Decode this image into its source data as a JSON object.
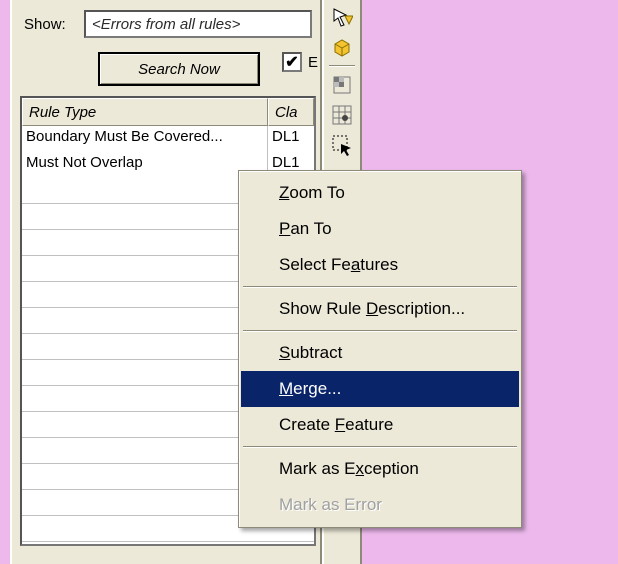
{
  "panel": {
    "show_label": "Show:",
    "show_value": "<Errors from all rules>",
    "search_button": "Search Now",
    "errors_only_check_letter": "E",
    "errors_only_checked": true
  },
  "grid": {
    "columns": [
      "Rule Type",
      "Cla"
    ],
    "rows": [
      {
        "rule": "Boundary Must Be Covered...",
        "class": "DL1"
      },
      {
        "rule": "Must Not Overlap",
        "class": "DL1"
      }
    ]
  },
  "toolbar": {
    "items": [
      "arrow-down-icon",
      "box-icon",
      "grid-select-icon",
      "grid-snap-icon",
      "select-frame-icon"
    ]
  },
  "context_menu": {
    "items": [
      {
        "id": "zoom-to",
        "label": "Zoom To",
        "ukey": "Z",
        "type": "item"
      },
      {
        "id": "pan-to",
        "label": "Pan To",
        "ukey": "P",
        "type": "item"
      },
      {
        "id": "select-feat",
        "label": "Select Features",
        "ukey": "a",
        "type": "item"
      },
      {
        "type": "sep"
      },
      {
        "id": "show-rule-desc",
        "label": "Show Rule Description...",
        "ukey": "D",
        "type": "item"
      },
      {
        "type": "sep"
      },
      {
        "id": "subtract",
        "label": "Subtract",
        "ukey": "S",
        "type": "item"
      },
      {
        "id": "merge",
        "label": "Merge...",
        "ukey": "M",
        "type": "item",
        "selected": true
      },
      {
        "id": "create-feature",
        "label": "Create Feature",
        "ukey": "F",
        "type": "item"
      },
      {
        "type": "sep"
      },
      {
        "id": "mark-exception",
        "label": "Mark as Exception",
        "ukey": "x",
        "type": "item"
      },
      {
        "id": "mark-error",
        "label": "Mark as Error",
        "ukey": "",
        "type": "item",
        "disabled": true
      }
    ]
  }
}
